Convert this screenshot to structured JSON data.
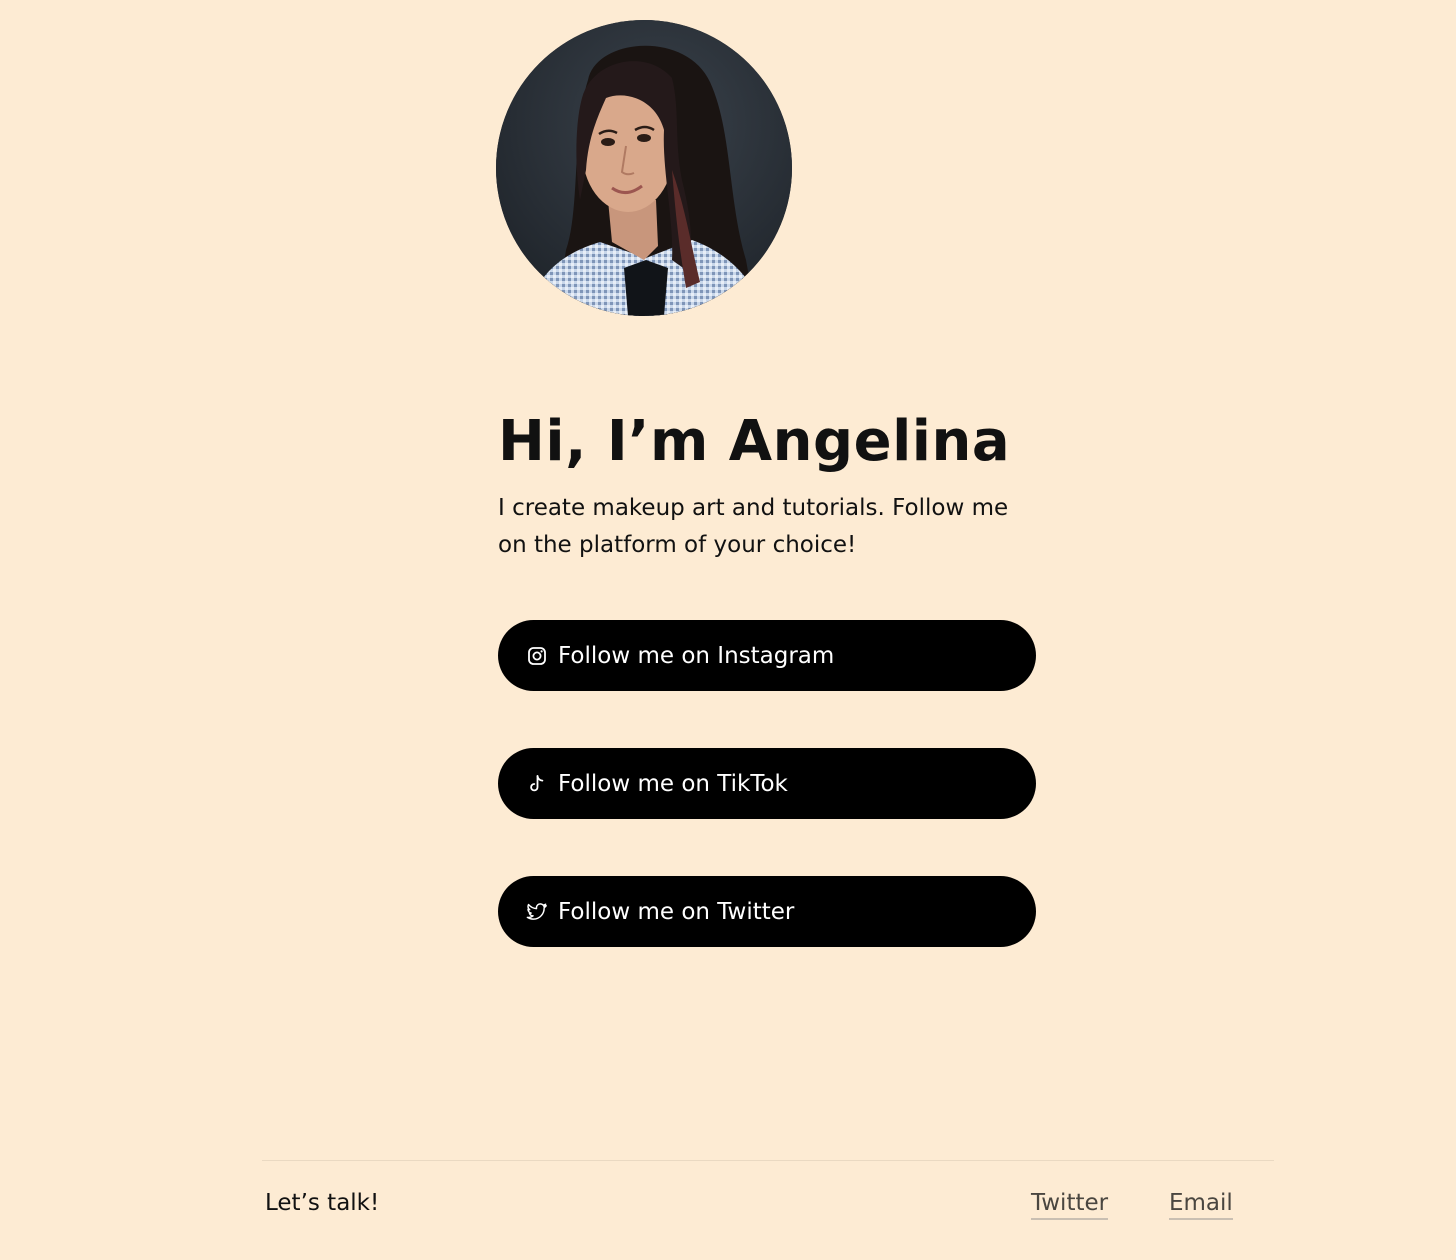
{
  "profile": {
    "avatar_alt": "Angelina profile photo"
  },
  "hero": {
    "title": "Hi, I’m Angelina",
    "subtitle": "I create makeup art and tutorials. Follow me on the platform of your choice!"
  },
  "buttons": [
    {
      "label": "Follow me on Instagram",
      "icon": "instagram-icon"
    },
    {
      "label": "Follow me on TikTok",
      "icon": "tiktok-icon"
    },
    {
      "label": "Follow me on Twitter",
      "icon": "twitter-icon"
    }
  ],
  "footer": {
    "text": "Let’s talk!",
    "links": [
      {
        "label": "Twitter"
      },
      {
        "label": "Email"
      }
    ]
  },
  "colors": {
    "background": "#fdebd3",
    "button": "#000000",
    "button_text": "#ffffff",
    "footer_link": "#4a4640"
  }
}
